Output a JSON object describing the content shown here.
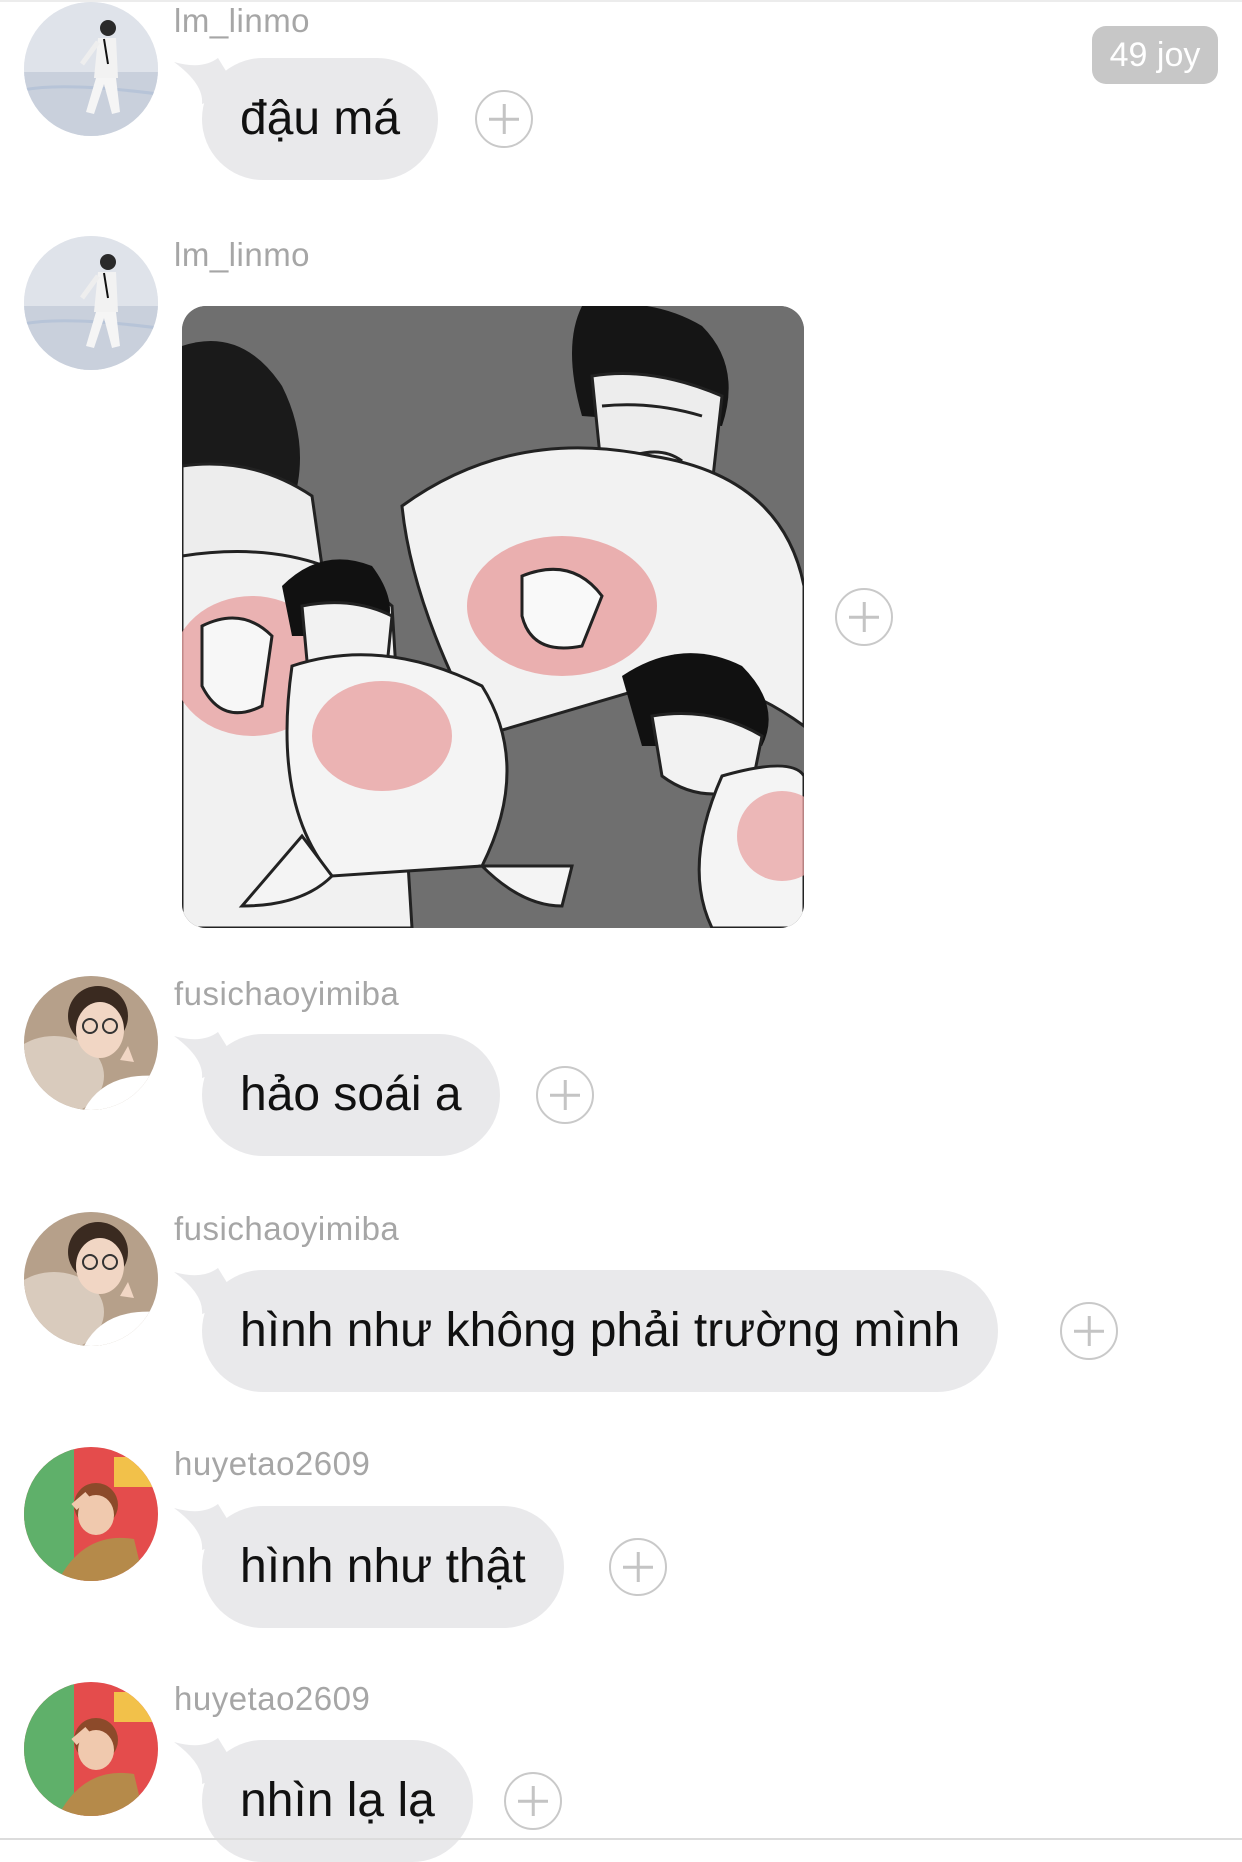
{
  "header": {
    "joy_badge": "49 joy"
  },
  "messages": [
    {
      "username": "lm_linmo",
      "text": "đậu má",
      "type": "text"
    },
    {
      "username": "lm_linmo",
      "type": "sticker",
      "sticker_name": "crying-characters-clutching-chest-sticker"
    },
    {
      "username": "fusichaoyimiba",
      "text": "hảo soái a",
      "type": "text"
    },
    {
      "username": "fusichaoyimiba",
      "text": "hình như không phải trường mình",
      "type": "text"
    },
    {
      "username": "huyetao2609",
      "text": "hình như thật",
      "type": "text"
    },
    {
      "username": "huyetao2609",
      "text": "nhìn lạ lạ",
      "type": "text"
    }
  ],
  "colors": {
    "bubble": "#e9e9eb",
    "username": "#a6a6a6",
    "badge": "#c7c7c7",
    "add_button": "#c9c9c9"
  },
  "icons": {
    "add": "plus-circle-icon"
  }
}
